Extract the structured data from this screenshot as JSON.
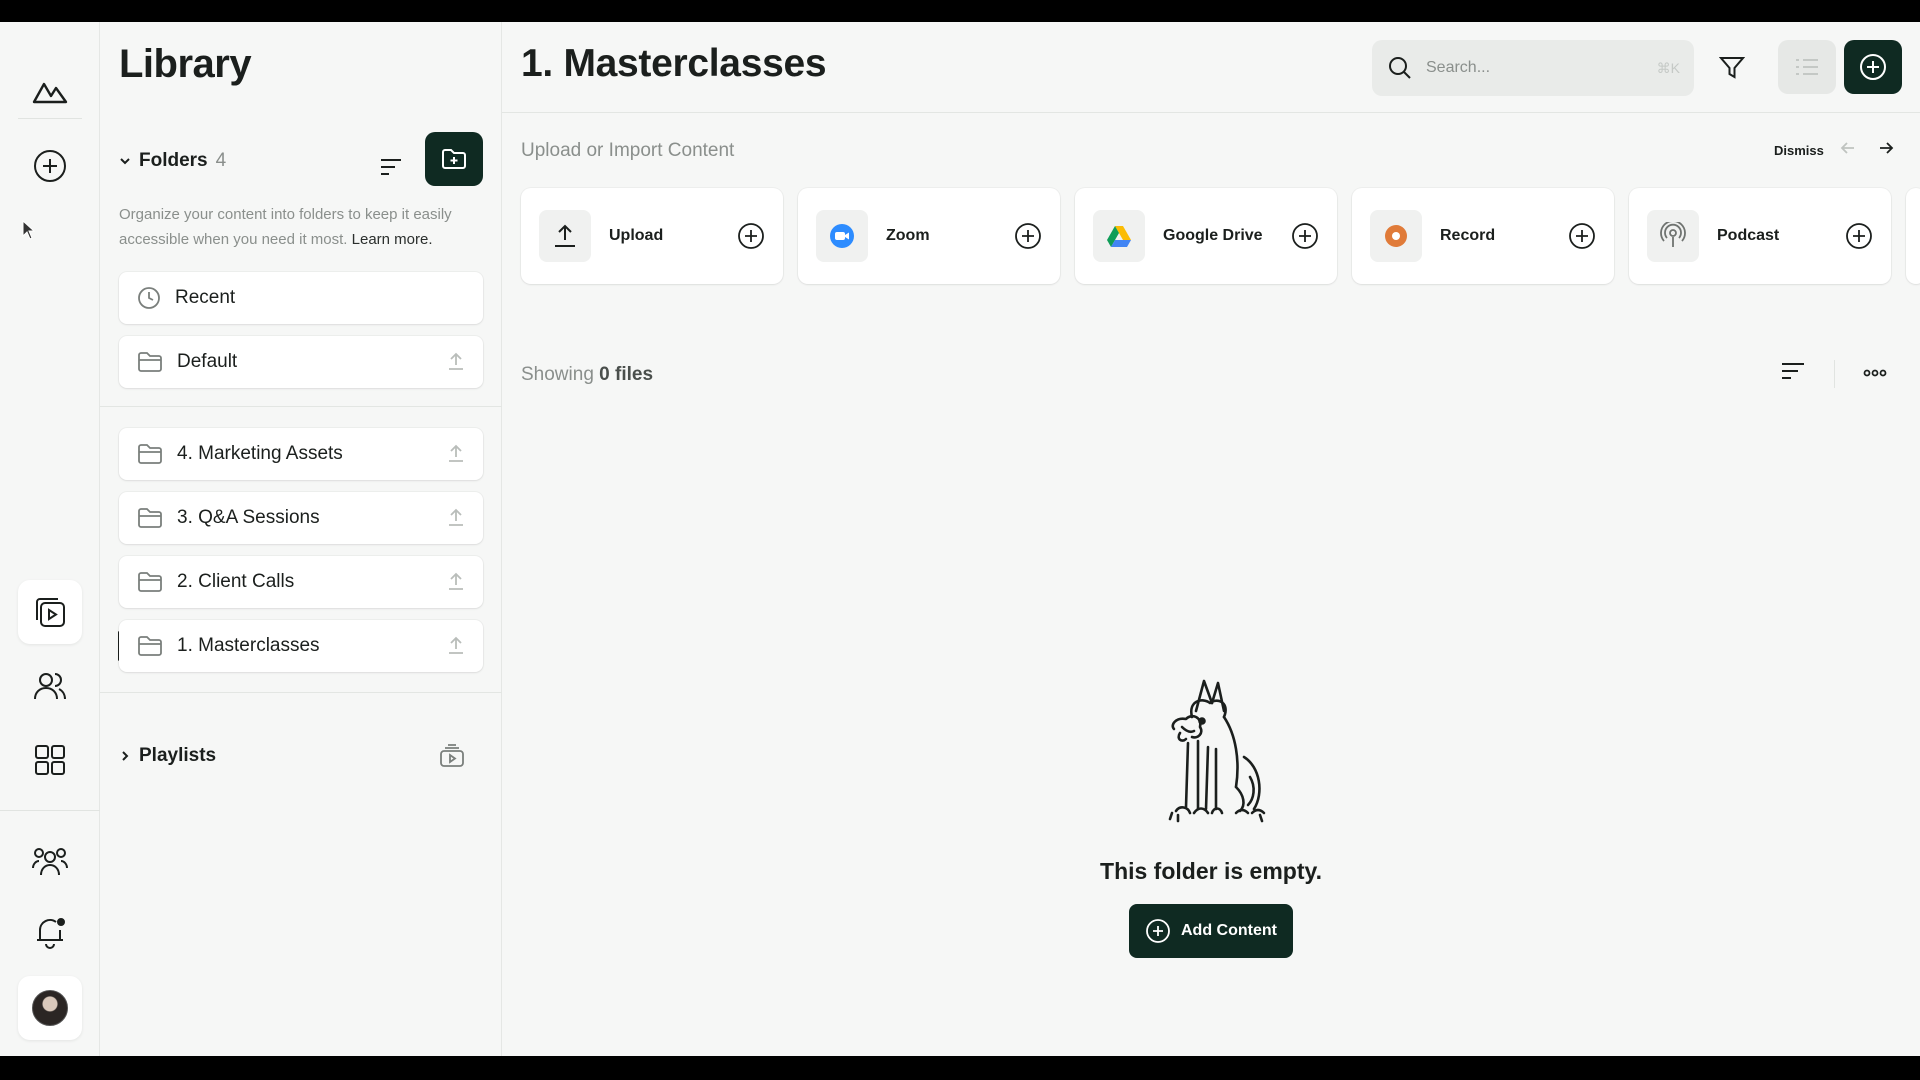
{
  "sidebar": {
    "title": "Library",
    "folders_label": "Folders",
    "folders_count": "4",
    "description": "Organize your content into folders to keep it easily accessible when you need it most.",
    "learn_more": "Learn more.",
    "pinned": [
      {
        "label": "Recent",
        "icon": "clock-icon"
      },
      {
        "label": "Default",
        "icon": "folder-icon"
      }
    ],
    "folders": [
      {
        "label": "4. Marketing Assets"
      },
      {
        "label": "3. Q&A Sessions"
      },
      {
        "label": "2. Client Calls"
      },
      {
        "label": "1. Masterclasses",
        "active": true
      }
    ],
    "playlists_label": "Playlists"
  },
  "main": {
    "title": "1. Masterclasses",
    "search": {
      "placeholder": "Search...",
      "shortcut": "⌘K"
    },
    "upload_title": "Upload or Import Content",
    "dismiss": "Dismiss",
    "sources": [
      {
        "label": "Upload",
        "icon": "upload-icon"
      },
      {
        "label": "Zoom",
        "icon": "zoom-icon"
      },
      {
        "label": "Google Drive",
        "icon": "google-drive-icon"
      },
      {
        "label": "Record",
        "icon": "record-icon"
      },
      {
        "label": "Podcast",
        "icon": "podcast-icon"
      }
    ],
    "showing_prefix": "Showing",
    "showing_count": "0 files",
    "empty_text": "This folder is empty.",
    "add_content": "Add Content"
  },
  "colors": {
    "accent": "#0f2a22",
    "background": "#f6f7f6",
    "zoom": "#2d8cff",
    "record": "#e07b39"
  }
}
